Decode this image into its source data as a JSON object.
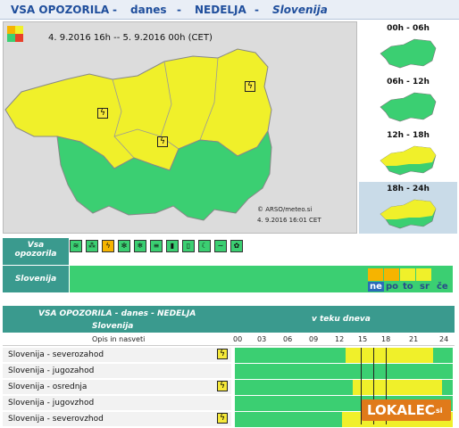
{
  "header": {
    "part1": "VSA OPOZORILA",
    "sep1": "-",
    "part2": "danes",
    "sep2": "-",
    "part3": "NEDELJA",
    "sep3": "-",
    "part4": "Slovenija"
  },
  "map": {
    "period": "4. 9.2016  16h  --  5. 9.2016  00h    (CET)",
    "credit": "© ARSO/meteo.si",
    "issued": "4. 9.2016   16:01 CET",
    "level_colors": {
      "yellow": "#f0f02a",
      "green": "#3bcf72",
      "orange": "#f6b400",
      "red": "#e8402a"
    }
  },
  "thumbnails": [
    {
      "label": "00h - 06h",
      "state": "green"
    },
    {
      "label": "06h - 12h",
      "state": "green"
    },
    {
      "label": "12h - 18h",
      "state": "yellow"
    },
    {
      "label": "18h - 24h",
      "state": "yellow"
    }
  ],
  "left_labels": {
    "all_warnings": "Vsa\nopozorila",
    "slovenia": "Slovenija"
  },
  "icon_bar": {
    "icons": [
      "wind-icon",
      "rain-icon",
      "storm-icon",
      "snow-icon",
      "ice-icon",
      "fog-icon",
      "heat-icon",
      "cold-icon",
      "uv-icon",
      "coast-icon",
      "pollen-icon"
    ]
  },
  "days": {
    "labels": [
      "ne",
      "po",
      "to",
      "sr",
      "če"
    ],
    "selected": "ne"
  },
  "table": {
    "title": "VSA OPOZORILA - danes - NEDELJA",
    "subtitle": "Slovenija",
    "timeline_title": "v teku dneva",
    "col_header": "Opis in nasveti",
    "hours": [
      "00",
      "03",
      "06",
      "09",
      "12",
      "15",
      "18",
      "21",
      "24"
    ],
    "rows": [
      {
        "region": "Slovenija - severozahod",
        "storm": true
      },
      {
        "region": "Slovenija - jugozahod",
        "storm": false
      },
      {
        "region": "Slovenija - osrednja",
        "storm": true
      },
      {
        "region": "Slovenija - jugovzhod",
        "storm": false
      },
      {
        "region": "Slovenija - severovzhod",
        "storm": true
      }
    ]
  },
  "logo": {
    "text": "LOKALEC",
    "suffix": ".si"
  }
}
